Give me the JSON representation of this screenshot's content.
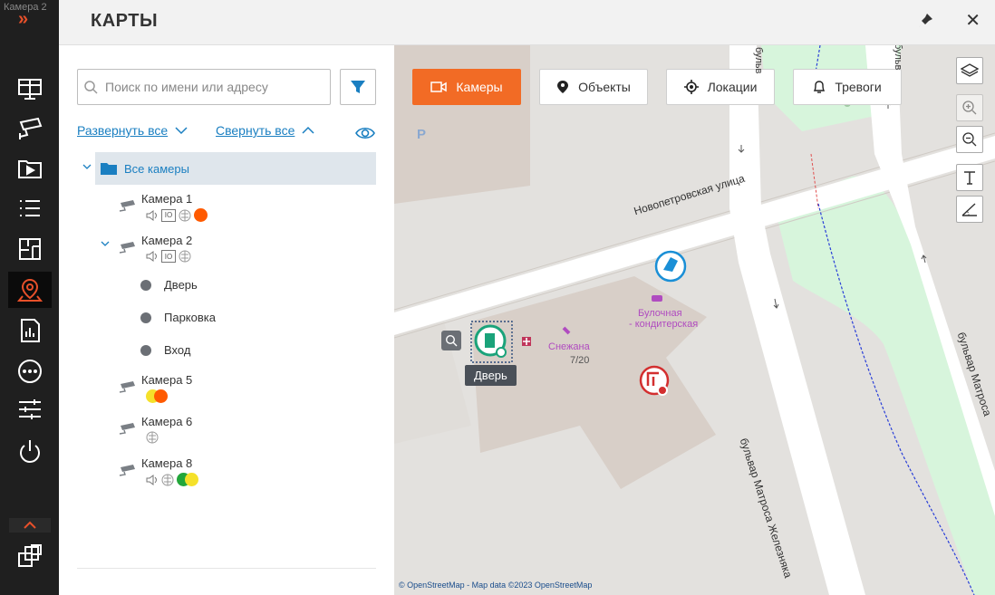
{
  "rail": {
    "camera_title": "Камера 2",
    "expand_glyph": "»"
  },
  "header": {
    "title": "КАРТЫ",
    "close_glyph": "✕"
  },
  "panel": {
    "search_placeholder": "Поиск по имени или адресу",
    "expand_all": "Развернуть все",
    "collapse_all": "Свернуть все",
    "root_label": "Все камеры",
    "cameras": [
      {
        "name": "Камера 1"
      },
      {
        "name": "Камера 2"
      },
      {
        "name": "Камера 5"
      },
      {
        "name": "Камера 6"
      },
      {
        "name": "Камера 8"
      }
    ],
    "sub_items": [
      "Дверь",
      "Парковка",
      "Вход"
    ]
  },
  "map": {
    "tabs": [
      {
        "label": "Камеры",
        "active": true
      },
      {
        "label": "Объекты",
        "active": false
      },
      {
        "label": "Локации",
        "active": false
      },
      {
        "label": "Тревоги",
        "active": false
      }
    ],
    "labels": {
      "street1": "Новопетровская улица",
      "street2": "бульвар Матроса Железняка",
      "street3": "бульвар Матроса",
      "street4": "бульв",
      "bakery": "Булочная",
      "bakery2": "- кондитерская",
      "shop": "Снежана",
      "address": "7/20",
      "parking": "P"
    },
    "tooltip": "Дверь",
    "attribution": "© OpenStreetMap - Map data ©2023 OpenStreetMap"
  },
  "colors": {
    "accent": "#f26b25",
    "link": "#1a7fc1",
    "orange_dot": "#ff5a00",
    "yellow_dot": "#f5e12a",
    "green_dot": "#22a63a",
    "door_marker": "#1aa37a",
    "alarm_marker": "#d32f2f",
    "camera_marker": "#1a8fd6"
  }
}
